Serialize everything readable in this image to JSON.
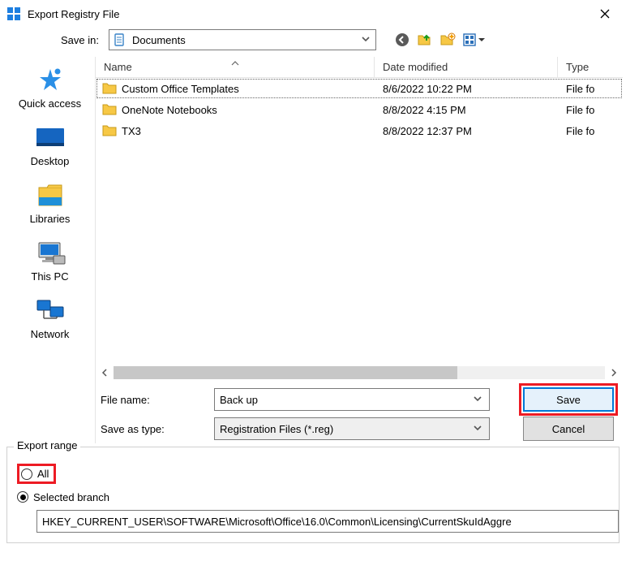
{
  "window": {
    "title": "Export Registry File"
  },
  "savein": {
    "label": "Save in:",
    "value": "Documents"
  },
  "columns": {
    "name": "Name",
    "date": "Date modified",
    "type": "Type"
  },
  "rows": [
    {
      "name": "Custom Office Templates",
      "date": "8/6/2022 10:22 PM",
      "type": "File fo",
      "selected": true
    },
    {
      "name": "OneNote Notebooks",
      "date": "8/8/2022 4:15 PM",
      "type": "File fo",
      "selected": false
    },
    {
      "name": "TX3",
      "date": "8/8/2022 12:37 PM",
      "type": "File fo",
      "selected": false
    }
  ],
  "leftnav": {
    "quick_access": "Quick access",
    "desktop": "Desktop",
    "libraries": "Libraries",
    "this_pc": "This PC",
    "network": "Network"
  },
  "filename": {
    "label": "File name:",
    "value": "Back up"
  },
  "savetype": {
    "label": "Save as type:",
    "value": "Registration Files (*.reg)"
  },
  "buttons": {
    "save": "Save",
    "cancel": "Cancel"
  },
  "export": {
    "legend": "Export range",
    "all": "All",
    "selected": "Selected branch",
    "branch_path": "HKEY_CURRENT_USER\\SOFTWARE\\Microsoft\\Office\\16.0\\Common\\Licensing\\CurrentSkuIdAggre"
  }
}
